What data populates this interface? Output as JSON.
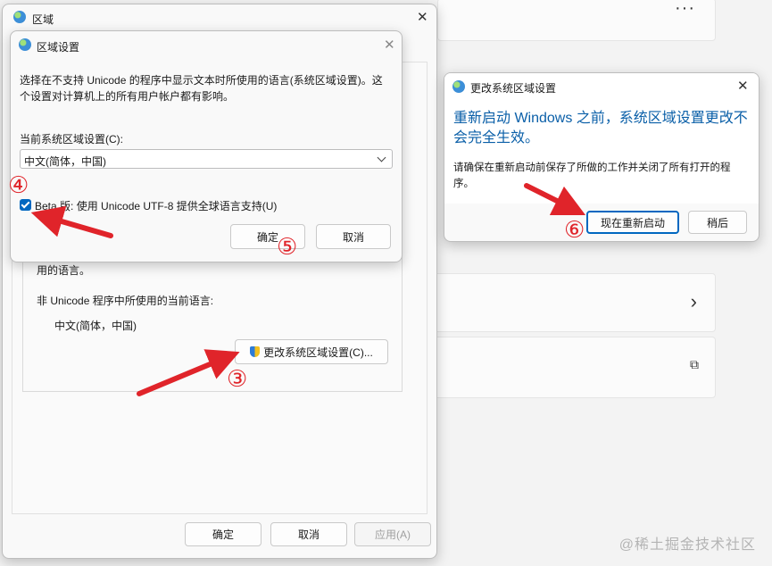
{
  "background": {
    "more_label": "···",
    "chevron_right": "›",
    "external_link": "⧉"
  },
  "region_window": {
    "title": "区域",
    "group_text_tail": "用的语言。",
    "non_unicode_label": "非 Unicode 程序中所使用的当前语言:",
    "current_language": "中文(简体，中国)",
    "change_locale_button": "更改系统区域设置(C)...",
    "ok_button": "确定",
    "cancel_button": "取消",
    "apply_button": "应用(A)"
  },
  "locale_dialog": {
    "title": "区域设置",
    "description": "选择在不支持 Unicode 的程序中显示文本时所使用的语言(系统区域设置)。这个设置对计算机上的所有用户帐户都有影响。",
    "current_label": "当前系统区域设置(C):",
    "current_value": "中文(简体，中国)",
    "beta_checkbox_label": "Beta 版: 使用 Unicode UTF-8 提供全球语言支持(U)",
    "beta_checked": true,
    "ok_button": "确定",
    "cancel_button": "取消"
  },
  "restart_dialog": {
    "title": "更改系统区域设置",
    "heading": "重新启动 Windows 之前，系统区域设置更改不会完全生效。",
    "body": "请确保在重新启动前保存了所做的工作并关闭了所有打开的程序。",
    "restart_button": "现在重新启动",
    "later_button": "稍后"
  },
  "annotations": {
    "step3": "③",
    "step4": "④",
    "step5": "⑤",
    "step6": "⑥",
    "arrow_color": "#e0242a"
  },
  "watermark": "@稀土掘金技术社区"
}
